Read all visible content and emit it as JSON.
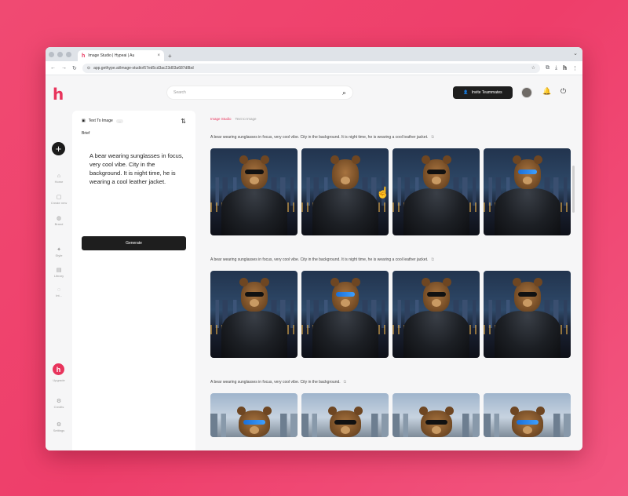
{
  "browser": {
    "tab_title": "Image Studio | Hypeai | Au",
    "tab_close": "×",
    "new_tab": "+",
    "url": "app.gethype.ai/image-studio/67ed5cd3ac23d03a687d8bd"
  },
  "app": {
    "logo": "h",
    "search_placeholder": "Search",
    "invite_label": "Invite Teammates"
  },
  "rail": {
    "items": [
      {
        "icon": "⌂",
        "label": "Home"
      },
      {
        "icon": "▢",
        "label": "Create new"
      },
      {
        "icon": "◍",
        "label": "Brand"
      },
      {
        "icon": "✦",
        "label": "Style"
      },
      {
        "icon": "▤",
        "label": "Library"
      },
      {
        "icon": "◌",
        "label": "Int..."
      }
    ],
    "bottom": [
      {
        "label": "Upgrade"
      },
      {
        "icon": "⚙",
        "label": "Credits"
      },
      {
        "icon": "⚙",
        "label": "Settings"
      }
    ],
    "h_badge": "h"
  },
  "panel": {
    "title": "Text To Image",
    "badge": "...",
    "brief_label": "Brief",
    "brief_text": "A bear wearing sunglasses in focus, very cool vibe.  City in the background.  It is night time, he is wearing a cool leather jacket.",
    "generate_label": "Generate"
  },
  "feed": {
    "breadcrumb": [
      "Image Studio",
      "Text to Image"
    ],
    "groups": [
      {
        "prompt": "A bear wearing sunglasses in focus, very cool vibe. City in the background. It is night time, he is wearing a cool leather jacket."
      },
      {
        "prompt": "A bear wearing sunglasses in focus, very cool vibe. City in the background. It is night time, he is wearing a cool leather jacket."
      },
      {
        "prompt": "A bear wearing sunglasses in focus, very cool vibe. City in the background."
      }
    ]
  },
  "colors": {
    "brand": "#e8345c",
    "background": "#ee3e6a",
    "dark_button": "#1e1e1e"
  }
}
